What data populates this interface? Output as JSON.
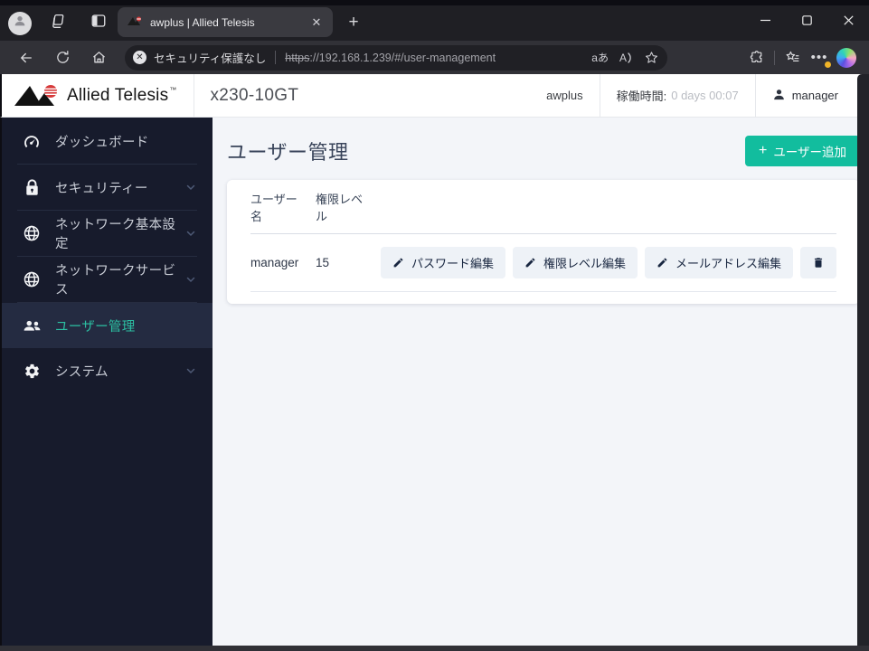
{
  "browser": {
    "tab_title": "awplus | Allied Telesis",
    "new_tab_label": "+",
    "security_label": "セキュリティ保護なし",
    "url_scheme": "https",
    "url_rest": "://192.168.1.239/#/user-management",
    "translate_button": "aあ",
    "read_aloud_button": "A",
    "more_menu": "•••"
  },
  "app_header": {
    "brand": "Allied Telesis",
    "trademark": "™",
    "device_model": "x230-10GT",
    "product_name": "awplus",
    "uptime_label": "稼働時間:",
    "uptime_value": "0 days 00:07",
    "username": "manager"
  },
  "sidebar": {
    "items": [
      {
        "label": "ダッシュボード",
        "icon": "dashboard-icon",
        "active": false,
        "expandable": false
      },
      {
        "label": "セキュリティー",
        "icon": "lock-icon",
        "active": false,
        "expandable": true
      },
      {
        "label": "ネットワーク基本設定",
        "icon": "globe-icon",
        "active": false,
        "expandable": true
      },
      {
        "label": "ネットワークサービス",
        "icon": "globe-icon",
        "active": false,
        "expandable": true
      },
      {
        "label": "ユーザー管理",
        "icon": "users-icon",
        "active": true,
        "expandable": false
      },
      {
        "label": "システム",
        "icon": "gear-icon",
        "active": false,
        "expandable": true
      }
    ]
  },
  "main": {
    "page_title": "ユーザー管理",
    "add_user_plus": "+",
    "add_user_label": "ユーザー追加",
    "table": {
      "col_username": "ユーザー名",
      "col_privilege": "権限レベル",
      "row": {
        "username": "manager",
        "privilege_level": "15",
        "edit_password_button": "パスワード編集",
        "edit_privilege_button": "権限レベル編集",
        "edit_email_button": "メールアドレス編集"
      }
    }
  },
  "colors": {
    "accent_teal": "#12bd9e",
    "sidebar_bg": "#171b2c",
    "sidebar_active_bg": "#242b41",
    "sidebar_active_text": "#2cbfa2",
    "content_bg": "#f3f5f9",
    "logo_red": "#d63a3a"
  }
}
